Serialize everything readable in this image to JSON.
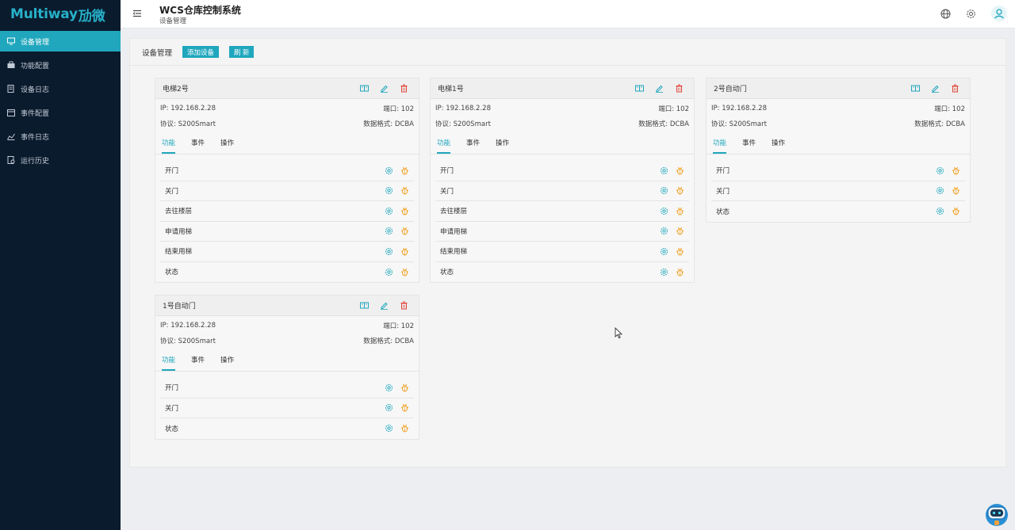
{
  "app": {
    "logo_text": "Multiway",
    "logo_cn": "劢微",
    "title": "WCS仓库控制系统",
    "breadcrumb": "设备管理"
  },
  "colors": {
    "accent": "#20a7bd",
    "sidebar_bg": "#0b1b2e",
    "danger": "#e0453a",
    "warn": "#f0a020"
  },
  "sidebar": {
    "items": [
      {
        "label": "设备管理",
        "icon": "monitor-icon",
        "active": true
      },
      {
        "label": "功能配置",
        "icon": "briefcase-icon",
        "active": false
      },
      {
        "label": "设备日志",
        "icon": "log-icon",
        "active": false
      },
      {
        "label": "事件配置",
        "icon": "calendar-icon",
        "active": false
      },
      {
        "label": "事件日志",
        "icon": "chart-icon",
        "active": false
      },
      {
        "label": "运行历史",
        "icon": "history-icon",
        "active": false
      }
    ]
  },
  "header_icons": [
    "globe-icon",
    "settings-icon",
    "user-avatar-icon"
  ],
  "toolbar": {
    "title": "设备管理",
    "add_label": "添加设备",
    "refresh_label": "刷 新"
  },
  "tabs": [
    "功能",
    "事件",
    "操作"
  ],
  "devices": [
    {
      "name": "电梯2号",
      "ip": "IP: 192.168.2.28",
      "port": "端口: 102",
      "protocol": "协议: S200Smart",
      "format": "数据格式: DCBA",
      "functions": [
        "开门",
        "关门",
        "去往楼层",
        "申请用梯",
        "结束用梯",
        "状态"
      ]
    },
    {
      "name": "电梯1号",
      "ip": "IP: 192.168.2.28",
      "port": "端口: 102",
      "protocol": "协议: S200Smart",
      "format": "数据格式: DCBA",
      "functions": [
        "开门",
        "关门",
        "去往楼层",
        "申请用梯",
        "结束用梯",
        "状态"
      ]
    },
    {
      "name": "2号自动门",
      "ip": "IP: 192.168.2.28",
      "port": "端口: 102",
      "protocol": "协议: S200Smart",
      "format": "数据格式: DCBA",
      "functions": [
        "开门",
        "关门",
        "状态"
      ]
    },
    {
      "name": "1号自动门",
      "ip": "IP: 192.168.2.28",
      "port": "端口: 102",
      "protocol": "协议: S200Smart",
      "format": "数据格式: DCBA",
      "functions": [
        "开门",
        "关门",
        "状态"
      ]
    }
  ]
}
